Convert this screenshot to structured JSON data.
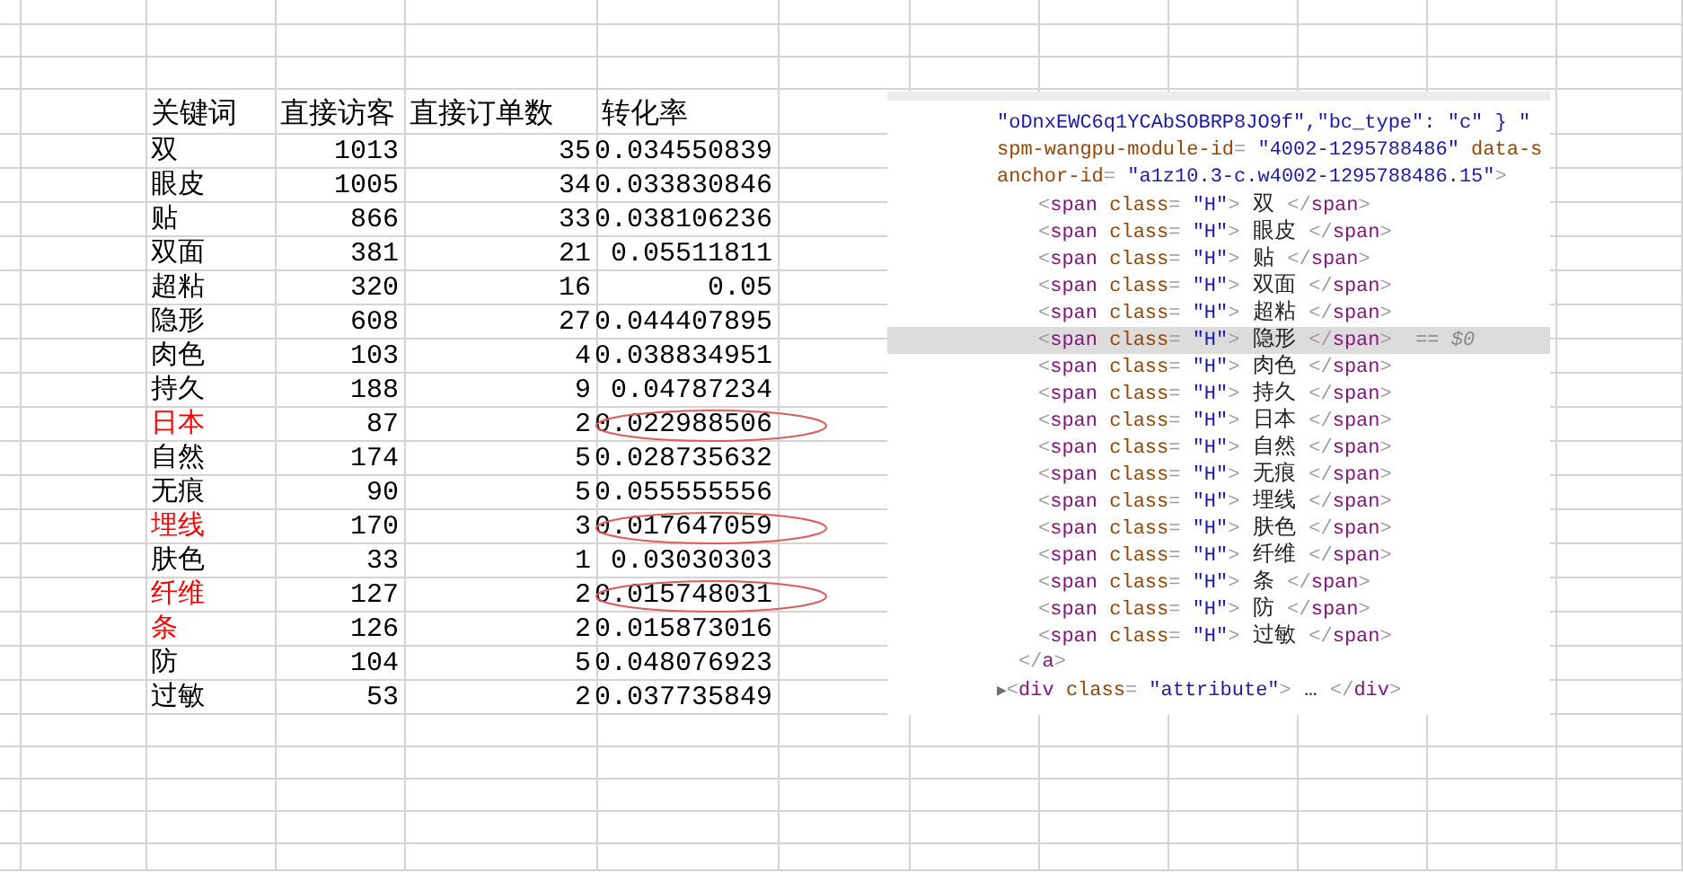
{
  "sheet": {
    "columns": [
      "关键词",
      "直接访客",
      "直接订单数",
      "转化率"
    ],
    "rows": [
      {
        "keyword": "双",
        "visitors": "1013",
        "orders": "35",
        "rate": "0.034550839",
        "flagged": false,
        "circled": false
      },
      {
        "keyword": "眼皮",
        "visitors": "1005",
        "orders": "34",
        "rate": "0.033830846",
        "flagged": false,
        "circled": false
      },
      {
        "keyword": "贴",
        "visitors": "866",
        "orders": "33",
        "rate": "0.038106236",
        "flagged": false,
        "circled": false
      },
      {
        "keyword": "双面",
        "visitors": "381",
        "orders": "21",
        "rate": "0.05511811",
        "flagged": false,
        "circled": false
      },
      {
        "keyword": "超粘",
        "visitors": "320",
        "orders": "16",
        "rate": "0.05",
        "flagged": false,
        "circled": false
      },
      {
        "keyword": "隐形",
        "visitors": "608",
        "orders": "27",
        "rate": "0.044407895",
        "flagged": false,
        "circled": false
      },
      {
        "keyword": "肉色",
        "visitors": "103",
        "orders": "4",
        "rate": "0.038834951",
        "flagged": false,
        "circled": false
      },
      {
        "keyword": "持久",
        "visitors": "188",
        "orders": "9",
        "rate": "0.04787234",
        "flagged": false,
        "circled": false
      },
      {
        "keyword": "日本",
        "visitors": "87",
        "orders": "2",
        "rate": "0.022988506",
        "flagged": true,
        "circled": true
      },
      {
        "keyword": "自然",
        "visitors": "174",
        "orders": "5",
        "rate": "0.028735632",
        "flagged": false,
        "circled": false
      },
      {
        "keyword": "无痕",
        "visitors": "90",
        "orders": "5",
        "rate": "0.055555556",
        "flagged": false,
        "circled": false
      },
      {
        "keyword": "埋线",
        "visitors": "170",
        "orders": "3",
        "rate": "0.017647059",
        "flagged": true,
        "circled": true
      },
      {
        "keyword": "肤色",
        "visitors": "33",
        "orders": "1",
        "rate": "0.03030303",
        "flagged": false,
        "circled": false
      },
      {
        "keyword": "纤维",
        "visitors": "127",
        "orders": "2",
        "rate": "0.015748031",
        "flagged": true,
        "circled": true
      },
      {
        "keyword": "条",
        "visitors": "126",
        "orders": "2",
        "rate": "0.015873016",
        "flagged": true,
        "circled": false
      },
      {
        "keyword": "防",
        "visitors": "104",
        "orders": "5",
        "rate": "0.048076923",
        "flagged": false,
        "circled": false
      },
      {
        "keyword": "过敏",
        "visitors": "53",
        "orders": "2",
        "rate": "0.037735849",
        "flagged": false,
        "circled": false
      }
    ]
  },
  "devtools": {
    "lines": [
      {
        "kind": "attr",
        "selected": false,
        "tokens": [
          {
            "kind": "attr-value",
            "text": "\"oDnxEWC6q1YCAbSOBRP8JO9f\",\"bc_type\": \"c\" } \""
          }
        ]
      },
      {
        "kind": "attr",
        "selected": false,
        "tokens": [
          {
            "kind": "attr-name",
            "text": "spm-wangpu-module-id"
          },
          {
            "kind": "punct",
            "text": "= "
          },
          {
            "kind": "attr-value",
            "text": "\"4002-1295788486\""
          },
          {
            "kind": "attr-name",
            "text": " data-s"
          }
        ]
      },
      {
        "kind": "attr",
        "selected": false,
        "tokens": [
          {
            "kind": "attr-name",
            "text": "anchor-id"
          },
          {
            "kind": "punct",
            "text": "= "
          },
          {
            "kind": "attr-value",
            "text": "\"a1z10.3-c.w4002-1295788486.15\""
          },
          {
            "kind": "punct",
            "text": ">"
          }
        ]
      },
      {
        "kind": "child",
        "selected": false,
        "tokens": [
          {
            "kind": "punct",
            "text": "<"
          },
          {
            "kind": "tag",
            "text": "span"
          },
          {
            "kind": "attr-name",
            "text": " class"
          },
          {
            "kind": "punct",
            "text": "= "
          },
          {
            "kind": "attr-value",
            "text": "\"H\""
          },
          {
            "kind": "punct",
            "text": ">"
          },
          {
            "kind": "text",
            "text": " 双 "
          },
          {
            "kind": "punct",
            "text": "</"
          },
          {
            "kind": "tag",
            "text": "span"
          },
          {
            "kind": "punct",
            "text": ">"
          }
        ]
      },
      {
        "kind": "child",
        "selected": false,
        "tokens": [
          {
            "kind": "punct",
            "text": "<"
          },
          {
            "kind": "tag",
            "text": "span"
          },
          {
            "kind": "attr-name",
            "text": " class"
          },
          {
            "kind": "punct",
            "text": "= "
          },
          {
            "kind": "attr-value",
            "text": "\"H\""
          },
          {
            "kind": "punct",
            "text": ">"
          },
          {
            "kind": "text",
            "text": " 眼皮 "
          },
          {
            "kind": "punct",
            "text": "</"
          },
          {
            "kind": "tag",
            "text": "span"
          },
          {
            "kind": "punct",
            "text": ">"
          }
        ]
      },
      {
        "kind": "child",
        "selected": false,
        "tokens": [
          {
            "kind": "punct",
            "text": "<"
          },
          {
            "kind": "tag",
            "text": "span"
          },
          {
            "kind": "attr-name",
            "text": " class"
          },
          {
            "kind": "punct",
            "text": "= "
          },
          {
            "kind": "attr-value",
            "text": "\"H\""
          },
          {
            "kind": "punct",
            "text": ">"
          },
          {
            "kind": "text",
            "text": " 贴 "
          },
          {
            "kind": "punct",
            "text": "</"
          },
          {
            "kind": "tag",
            "text": "span"
          },
          {
            "kind": "punct",
            "text": ">"
          }
        ]
      },
      {
        "kind": "child",
        "selected": false,
        "tokens": [
          {
            "kind": "punct",
            "text": "<"
          },
          {
            "kind": "tag",
            "text": "span"
          },
          {
            "kind": "attr-name",
            "text": " class"
          },
          {
            "kind": "punct",
            "text": "= "
          },
          {
            "kind": "attr-value",
            "text": "\"H\""
          },
          {
            "kind": "punct",
            "text": ">"
          },
          {
            "kind": "text",
            "text": " 双面 "
          },
          {
            "kind": "punct",
            "text": "</"
          },
          {
            "kind": "tag",
            "text": "span"
          },
          {
            "kind": "punct",
            "text": ">"
          }
        ]
      },
      {
        "kind": "child",
        "selected": false,
        "tokens": [
          {
            "kind": "punct",
            "text": "<"
          },
          {
            "kind": "tag",
            "text": "span"
          },
          {
            "kind": "attr-name",
            "text": " class"
          },
          {
            "kind": "punct",
            "text": "= "
          },
          {
            "kind": "attr-value",
            "text": "\"H\""
          },
          {
            "kind": "punct",
            "text": ">"
          },
          {
            "kind": "text",
            "text": " 超粘 "
          },
          {
            "kind": "punct",
            "text": "</"
          },
          {
            "kind": "tag",
            "text": "span"
          },
          {
            "kind": "punct",
            "text": ">"
          }
        ]
      },
      {
        "kind": "child",
        "selected": true,
        "tokens": [
          {
            "kind": "punct",
            "text": "<"
          },
          {
            "kind": "tag",
            "text": "span"
          },
          {
            "kind": "attr-name",
            "text": " class"
          },
          {
            "kind": "punct",
            "text": "= "
          },
          {
            "kind": "attr-value",
            "text": "\"H\""
          },
          {
            "kind": "punct",
            "text": ">"
          },
          {
            "kind": "text",
            "text": " 隐形 "
          },
          {
            "kind": "punct",
            "text": "</"
          },
          {
            "kind": "tag",
            "text": "span"
          },
          {
            "kind": "punct",
            "text": ">"
          },
          {
            "kind": "ref",
            "text": "  == $0"
          }
        ]
      },
      {
        "kind": "child",
        "selected": false,
        "tokens": [
          {
            "kind": "punct",
            "text": "<"
          },
          {
            "kind": "tag",
            "text": "span"
          },
          {
            "kind": "attr-name",
            "text": " class"
          },
          {
            "kind": "punct",
            "text": "= "
          },
          {
            "kind": "attr-value",
            "text": "\"H\""
          },
          {
            "kind": "punct",
            "text": ">"
          },
          {
            "kind": "text",
            "text": " 肉色 "
          },
          {
            "kind": "punct",
            "text": "</"
          },
          {
            "kind": "tag",
            "text": "span"
          },
          {
            "kind": "punct",
            "text": ">"
          }
        ]
      },
      {
        "kind": "child",
        "selected": false,
        "tokens": [
          {
            "kind": "punct",
            "text": "<"
          },
          {
            "kind": "tag",
            "text": "span"
          },
          {
            "kind": "attr-name",
            "text": " class"
          },
          {
            "kind": "punct",
            "text": "= "
          },
          {
            "kind": "attr-value",
            "text": "\"H\""
          },
          {
            "kind": "punct",
            "text": ">"
          },
          {
            "kind": "text",
            "text": " 持久 "
          },
          {
            "kind": "punct",
            "text": "</"
          },
          {
            "kind": "tag",
            "text": "span"
          },
          {
            "kind": "punct",
            "text": ">"
          }
        ]
      },
      {
        "kind": "child",
        "selected": false,
        "tokens": [
          {
            "kind": "punct",
            "text": "<"
          },
          {
            "kind": "tag",
            "text": "span"
          },
          {
            "kind": "attr-name",
            "text": " class"
          },
          {
            "kind": "punct",
            "text": "= "
          },
          {
            "kind": "attr-value",
            "text": "\"H\""
          },
          {
            "kind": "punct",
            "text": ">"
          },
          {
            "kind": "text",
            "text": " 日本 "
          },
          {
            "kind": "punct",
            "text": "</"
          },
          {
            "kind": "tag",
            "text": "span"
          },
          {
            "kind": "punct",
            "text": ">"
          }
        ]
      },
      {
        "kind": "child",
        "selected": false,
        "tokens": [
          {
            "kind": "punct",
            "text": "<"
          },
          {
            "kind": "tag",
            "text": "span"
          },
          {
            "kind": "attr-name",
            "text": " class"
          },
          {
            "kind": "punct",
            "text": "= "
          },
          {
            "kind": "attr-value",
            "text": "\"H\""
          },
          {
            "kind": "punct",
            "text": ">"
          },
          {
            "kind": "text",
            "text": " 自然 "
          },
          {
            "kind": "punct",
            "text": "</"
          },
          {
            "kind": "tag",
            "text": "span"
          },
          {
            "kind": "punct",
            "text": ">"
          }
        ]
      },
      {
        "kind": "child",
        "selected": false,
        "tokens": [
          {
            "kind": "punct",
            "text": "<"
          },
          {
            "kind": "tag",
            "text": "span"
          },
          {
            "kind": "attr-name",
            "text": " class"
          },
          {
            "kind": "punct",
            "text": "= "
          },
          {
            "kind": "attr-value",
            "text": "\"H\""
          },
          {
            "kind": "punct",
            "text": ">"
          },
          {
            "kind": "text",
            "text": " 无痕 "
          },
          {
            "kind": "punct",
            "text": "</"
          },
          {
            "kind": "tag",
            "text": "span"
          },
          {
            "kind": "punct",
            "text": ">"
          }
        ]
      },
      {
        "kind": "child",
        "selected": false,
        "tokens": [
          {
            "kind": "punct",
            "text": "<"
          },
          {
            "kind": "tag",
            "text": "span"
          },
          {
            "kind": "attr-name",
            "text": " class"
          },
          {
            "kind": "punct",
            "text": "= "
          },
          {
            "kind": "attr-value",
            "text": "\"H\""
          },
          {
            "kind": "punct",
            "text": ">"
          },
          {
            "kind": "text",
            "text": " 埋线 "
          },
          {
            "kind": "punct",
            "text": "</"
          },
          {
            "kind": "tag",
            "text": "span"
          },
          {
            "kind": "punct",
            "text": ">"
          }
        ]
      },
      {
        "kind": "child",
        "selected": false,
        "tokens": [
          {
            "kind": "punct",
            "text": "<"
          },
          {
            "kind": "tag",
            "text": "span"
          },
          {
            "kind": "attr-name",
            "text": " class"
          },
          {
            "kind": "punct",
            "text": "= "
          },
          {
            "kind": "attr-value",
            "text": "\"H\""
          },
          {
            "kind": "punct",
            "text": ">"
          },
          {
            "kind": "text",
            "text": " 肤色 "
          },
          {
            "kind": "punct",
            "text": "</"
          },
          {
            "kind": "tag",
            "text": "span"
          },
          {
            "kind": "punct",
            "text": ">"
          }
        ]
      },
      {
        "kind": "child",
        "selected": false,
        "tokens": [
          {
            "kind": "punct",
            "text": "<"
          },
          {
            "kind": "tag",
            "text": "span"
          },
          {
            "kind": "attr-name",
            "text": " class"
          },
          {
            "kind": "punct",
            "text": "= "
          },
          {
            "kind": "attr-value",
            "text": "\"H\""
          },
          {
            "kind": "punct",
            "text": ">"
          },
          {
            "kind": "text",
            "text": " 纤维 "
          },
          {
            "kind": "punct",
            "text": "</"
          },
          {
            "kind": "tag",
            "text": "span"
          },
          {
            "kind": "punct",
            "text": ">"
          }
        ]
      },
      {
        "kind": "child",
        "selected": false,
        "tokens": [
          {
            "kind": "punct",
            "text": "<"
          },
          {
            "kind": "tag",
            "text": "span"
          },
          {
            "kind": "attr-name",
            "text": " class"
          },
          {
            "kind": "punct",
            "text": "= "
          },
          {
            "kind": "attr-value",
            "text": "\"H\""
          },
          {
            "kind": "punct",
            "text": ">"
          },
          {
            "kind": "text",
            "text": " 条 "
          },
          {
            "kind": "punct",
            "text": "</"
          },
          {
            "kind": "tag",
            "text": "span"
          },
          {
            "kind": "punct",
            "text": ">"
          }
        ]
      },
      {
        "kind": "child",
        "selected": false,
        "tokens": [
          {
            "kind": "punct",
            "text": "<"
          },
          {
            "kind": "tag",
            "text": "span"
          },
          {
            "kind": "attr-name",
            "text": " class"
          },
          {
            "kind": "punct",
            "text": "= "
          },
          {
            "kind": "attr-value",
            "text": "\"H\""
          },
          {
            "kind": "punct",
            "text": ">"
          },
          {
            "kind": "text",
            "text": " 防 "
          },
          {
            "kind": "punct",
            "text": "</"
          },
          {
            "kind": "tag",
            "text": "span"
          },
          {
            "kind": "punct",
            "text": ">"
          }
        ]
      },
      {
        "kind": "child",
        "selected": false,
        "tokens": [
          {
            "kind": "punct",
            "text": "<"
          },
          {
            "kind": "tag",
            "text": "span"
          },
          {
            "kind": "attr-name",
            "text": " class"
          },
          {
            "kind": "punct",
            "text": "= "
          },
          {
            "kind": "attr-value",
            "text": "\"H\""
          },
          {
            "kind": "punct",
            "text": ">"
          },
          {
            "kind": "text",
            "text": " 过敏 "
          },
          {
            "kind": "punct",
            "text": "</"
          },
          {
            "kind": "tag",
            "text": "span"
          },
          {
            "kind": "punct",
            "text": ">"
          }
        ]
      },
      {
        "kind": "close",
        "selected": false,
        "tokens": [
          {
            "kind": "punct",
            "text": "</"
          },
          {
            "kind": "tag",
            "text": "a"
          },
          {
            "kind": "punct",
            "text": ">"
          }
        ]
      },
      {
        "kind": "collapsed",
        "selected": false,
        "tokens": [
          {
            "kind": "expander",
            "text": "▶"
          },
          {
            "kind": "punct",
            "text": "<"
          },
          {
            "kind": "tag",
            "text": "div"
          },
          {
            "kind": "attr-name",
            "text": " class"
          },
          {
            "kind": "punct",
            "text": "= "
          },
          {
            "kind": "attr-value",
            "text": "\"attribute\""
          },
          {
            "kind": "punct",
            "text": ">"
          },
          {
            "kind": "text",
            "text": " … "
          },
          {
            "kind": "punct",
            "text": "</"
          },
          {
            "kind": "tag",
            "text": "div"
          },
          {
            "kind": "punct",
            "text": ">"
          }
        ]
      }
    ]
  }
}
